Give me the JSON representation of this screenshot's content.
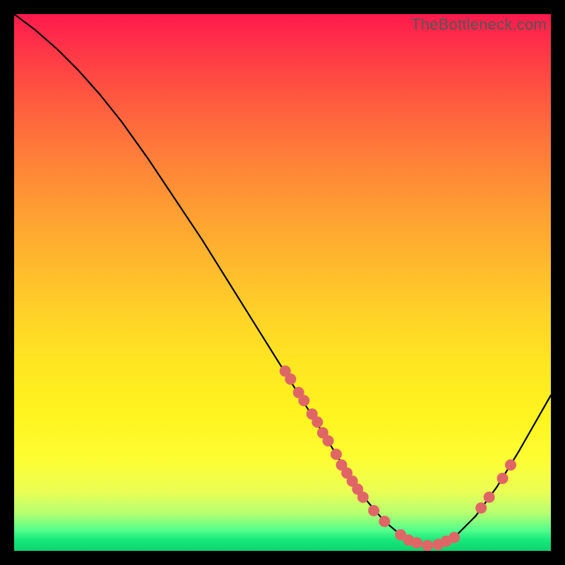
{
  "watermark": "TheBottleneck.com",
  "chart_data": {
    "type": "line",
    "title": "",
    "xlabel": "",
    "ylabel": "",
    "xlim": [
      0,
      100
    ],
    "ylim": [
      0,
      100
    ],
    "grid": false,
    "legend": false,
    "series": [
      {
        "name": "curve",
        "x": [
          0,
          4,
          8,
          12,
          16,
          20,
          25,
          30,
          35,
          40,
          45,
          50,
          55,
          60,
          63,
          66,
          69,
          72,
          75,
          78,
          82,
          86,
          90,
          94,
          98,
          100
        ],
        "y": [
          100,
          97,
          93.5,
          89.5,
          85,
          80,
          73,
          65.5,
          58,
          50,
          42,
          34,
          26,
          18,
          13,
          9,
          5.5,
          3,
          1.5,
          1,
          2.5,
          6.5,
          12,
          18.5,
          25.5,
          29
        ]
      }
    ],
    "markers": [
      {
        "x": 50.5,
        "y": 33.5
      },
      {
        "x": 51.5,
        "y": 32
      },
      {
        "x": 53,
        "y": 29.5
      },
      {
        "x": 54,
        "y": 28
      },
      {
        "x": 55.5,
        "y": 25.5
      },
      {
        "x": 56.5,
        "y": 24
      },
      {
        "x": 57.5,
        "y": 22
      },
      {
        "x": 58.5,
        "y": 20.5
      },
      {
        "x": 60,
        "y": 18
      },
      {
        "x": 61,
        "y": 16
      },
      {
        "x": 62,
        "y": 14.5
      },
      {
        "x": 63,
        "y": 13
      },
      {
        "x": 64,
        "y": 11.5
      },
      {
        "x": 65,
        "y": 10
      },
      {
        "x": 67,
        "y": 7.5
      },
      {
        "x": 69,
        "y": 5.5
      },
      {
        "x": 72,
        "y": 3
      },
      {
        "x": 73.5,
        "y": 2
      },
      {
        "x": 75,
        "y": 1.5
      },
      {
        "x": 77,
        "y": 1
      },
      {
        "x": 79,
        "y": 1.2
      },
      {
        "x": 80.5,
        "y": 1.8
      },
      {
        "x": 82,
        "y": 2.5
      },
      {
        "x": 87,
        "y": 8
      },
      {
        "x": 88.5,
        "y": 10
      },
      {
        "x": 91,
        "y": 13.5
      },
      {
        "x": 92.5,
        "y": 16
      }
    ],
    "colors": {
      "curve": "#000000",
      "marker": "#e06666"
    }
  }
}
